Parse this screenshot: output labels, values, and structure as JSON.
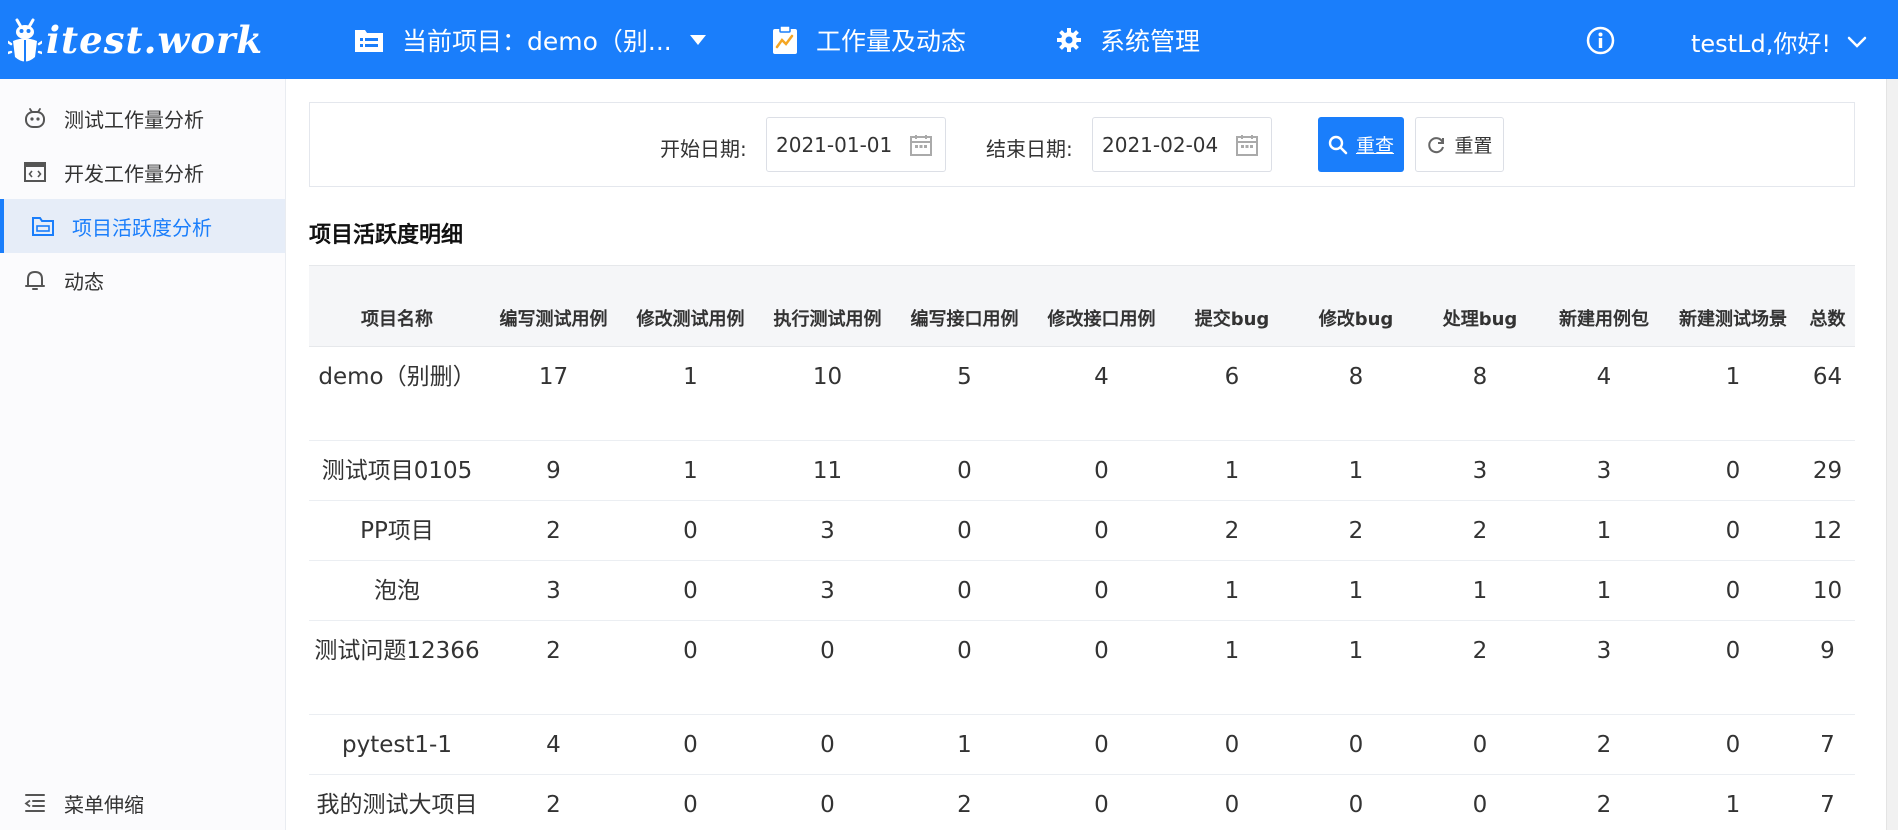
{
  "header": {
    "logo_text": "itest.work",
    "project_selector": {
      "label": "当前项目：demo（别..."
    },
    "nav_workload": "工作量及动态",
    "nav_system": "系统管理",
    "user_greeting": "testLd,你好!"
  },
  "sidebar": {
    "items": [
      {
        "label": "测试工作量分析",
        "icon": "robot-icon",
        "active": false
      },
      {
        "label": "开发工作量分析",
        "icon": "code-window-icon",
        "active": false
      },
      {
        "label": "项目活跃度分析",
        "icon": "folder-window-icon",
        "active": true
      },
      {
        "label": "动态",
        "icon": "bell-icon",
        "active": false
      }
    ],
    "collapse_label": "菜单伸缩"
  },
  "filter": {
    "start_label": "开始日期:",
    "start_value": "2021-01-01",
    "end_label": "结束日期:",
    "end_value": "2021-02-04",
    "search_button": "重查",
    "reset_button": "重置"
  },
  "section_title": "项目活跃度明细",
  "table": {
    "headers": [
      "项目名称",
      "编写测试用例",
      "修改测试用例",
      "执行测试用例",
      "编写接口用例",
      "修改接口用例",
      "提交bug",
      "修改bug",
      "处理bug",
      "新建用例包",
      "新建测试场景",
      "总数"
    ],
    "rows": [
      [
        "demo（别删）",
        "17",
        "1",
        "10",
        "5",
        "4",
        "6",
        "8",
        "8",
        "4",
        "1",
        "64"
      ],
      [
        "测试项目0105",
        "9",
        "1",
        "11",
        "0",
        "0",
        "1",
        "1",
        "3",
        "3",
        "0",
        "29"
      ],
      [
        "PP项目",
        "2",
        "0",
        "3",
        "0",
        "0",
        "2",
        "2",
        "2",
        "1",
        "0",
        "12"
      ],
      [
        "泡泡",
        "3",
        "0",
        "3",
        "0",
        "0",
        "1",
        "1",
        "1",
        "1",
        "0",
        "10"
      ],
      [
        "测试问题12366",
        "2",
        "0",
        "0",
        "0",
        "0",
        "1",
        "1",
        "2",
        "3",
        "0",
        "9"
      ],
      [
        "pytest1-1",
        "4",
        "0",
        "0",
        "1",
        "0",
        "0",
        "0",
        "0",
        "2",
        "0",
        "7"
      ],
      [
        "我的测试大项目",
        "2",
        "0",
        "0",
        "2",
        "0",
        "0",
        "0",
        "0",
        "2",
        "1",
        "7"
      ]
    ]
  },
  "colors": {
    "primary": "#1a7efb",
    "sidebar_active_bg": "#e6edf8",
    "table_header_bg": "#f5f6f8"
  }
}
